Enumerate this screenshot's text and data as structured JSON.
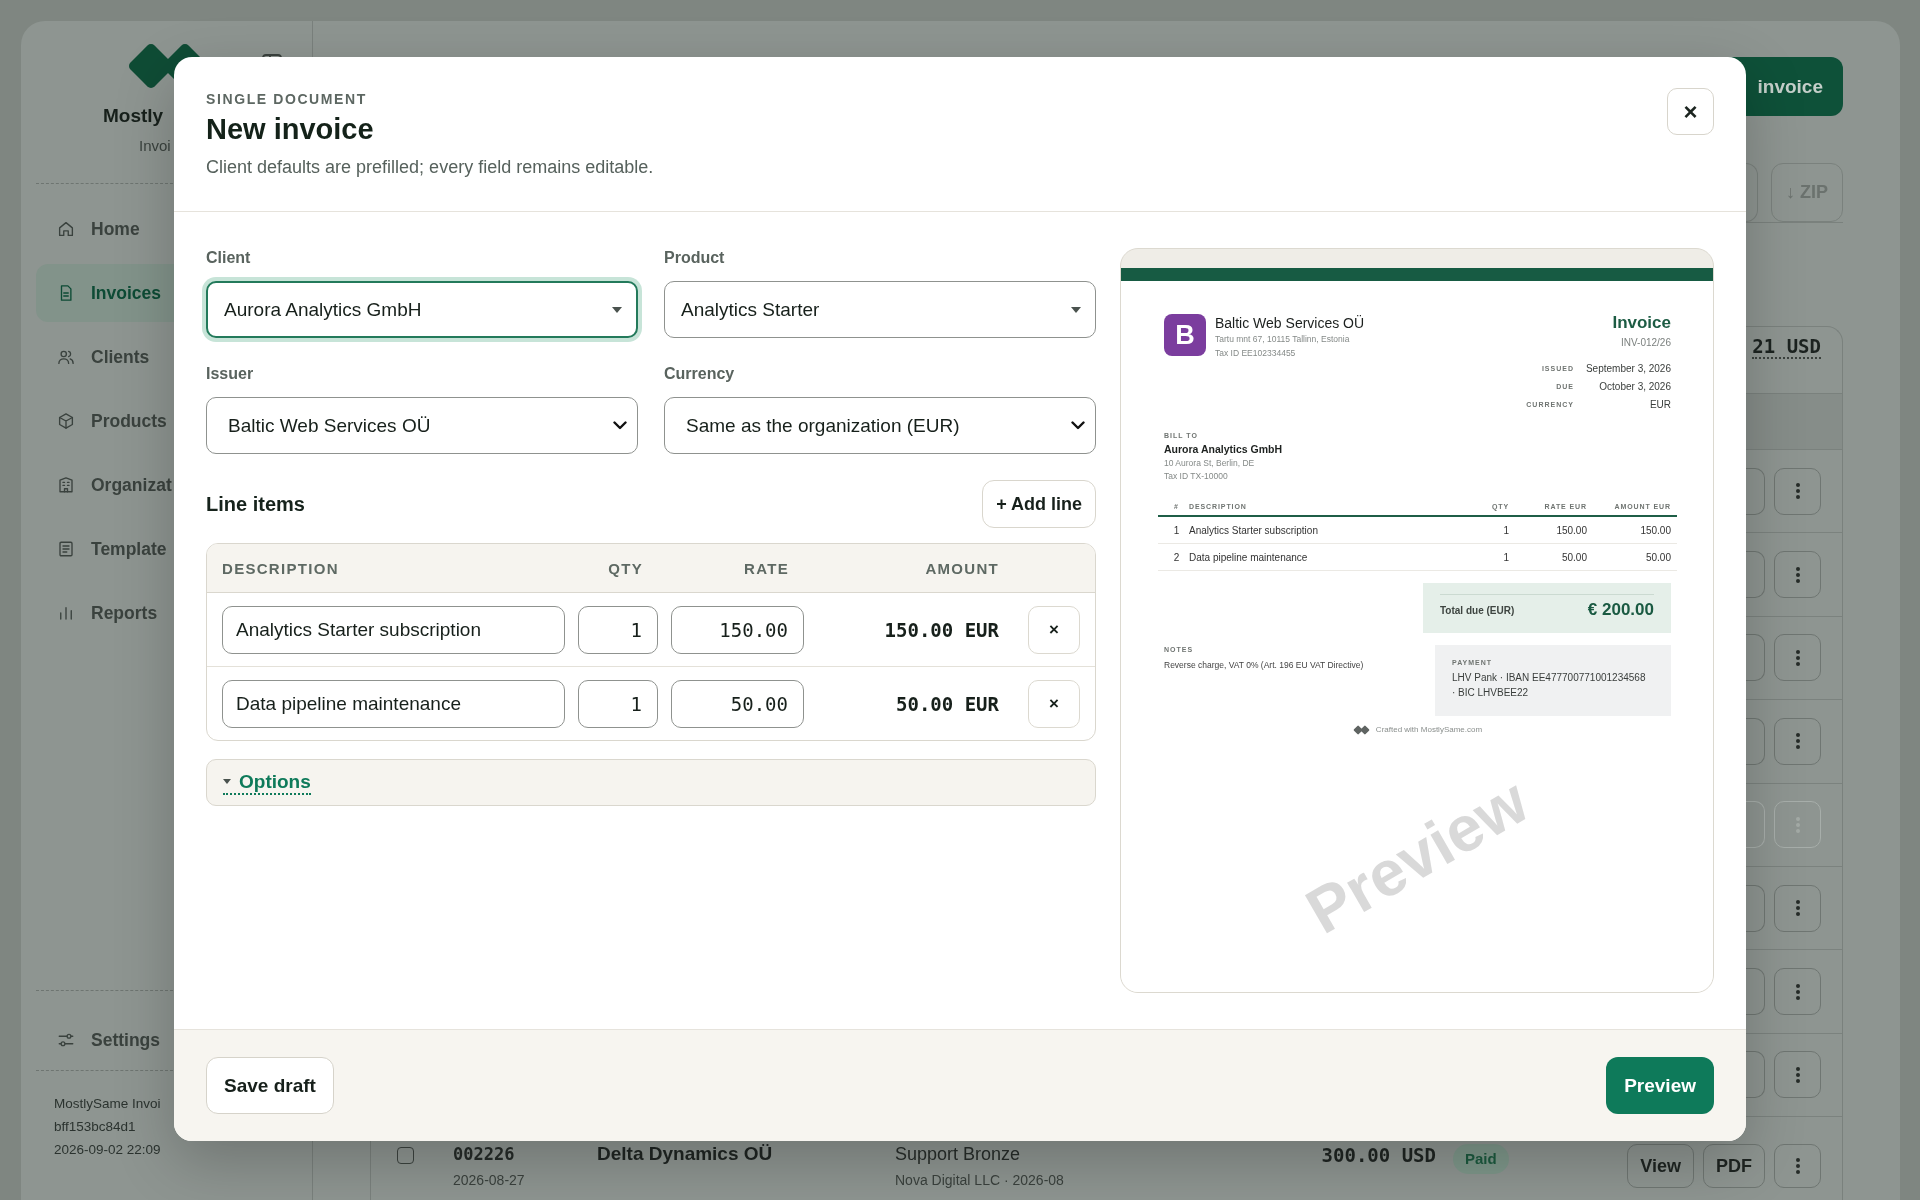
{
  "app": {
    "brand": {
      "name": "Mostly",
      "subtitle": "Invoi"
    },
    "nav": [
      {
        "label": "Home",
        "selected": false
      },
      {
        "label": "Invoices",
        "selected": true
      },
      {
        "label": "Clients",
        "selected": false
      },
      {
        "label": "Products",
        "selected": false
      },
      {
        "label": "Organizat",
        "selected": false
      },
      {
        "label": "Template",
        "selected": false
      },
      {
        "label": "Reports",
        "selected": false
      }
    ],
    "settings": "Settings",
    "build_info": [
      "MostlySame Invoi",
      "bff153bc84d1",
      "2026-09-02 22:09"
    ]
  },
  "main": {
    "new_invoice_button": "invoice",
    "zip_button": {
      "label": "↓ ZIP",
      "disabled": true
    },
    "total": "21 USD",
    "rows": [
      {
        "actions_disabled": false
      },
      {
        "actions_disabled": false
      },
      {
        "actions_disabled": false
      },
      {
        "actions_disabled": false
      },
      {
        "actions_disabled": true
      },
      {
        "actions_disabled": false
      },
      {
        "actions_disabled": false
      },
      {
        "actions_disabled": false
      }
    ],
    "last_row": {
      "checked": false,
      "number": "002226",
      "date": "2026-08-27",
      "client": "Delta Dynamics OÜ",
      "product": "Support Bronze",
      "meta": "Nova Digital LLC · 2026-08",
      "amount": "300.00 USD",
      "status": "Paid",
      "actions": [
        "View",
        "PDF"
      ]
    }
  },
  "modal": {
    "eyebrow": "SINGLE DOCUMENT",
    "title": "New invoice",
    "subtitle": "Client defaults are prefilled; every field remains editable.",
    "close": "×",
    "fields": [
      {
        "label": "Client",
        "value": "Aurora Analytics GmbH",
        "kind": "combobox",
        "focused": true
      },
      {
        "label": "Product",
        "value": "Analytics Starter",
        "kind": "combobox",
        "focused": false
      },
      {
        "label": "Issuer",
        "value": "Baltic Web Services OÜ",
        "kind": "select",
        "focused": false
      },
      {
        "label": "Currency",
        "value": "Same as the organization (EUR)",
        "kind": "select",
        "focused": false
      }
    ],
    "line_items": {
      "title": "Line items",
      "add_button": "+ Add line",
      "columns": [
        "DESCRIPTION",
        "QTY",
        "RATE",
        "AMOUNT"
      ],
      "rows": [
        {
          "description": "Analytics Starter subscription",
          "qty": "1",
          "rate": "150.00",
          "amount": "150.00 EUR",
          "remove": "×"
        },
        {
          "description": "Data pipeline maintenance",
          "qty": "1",
          "rate": "50.00",
          "amount": "50.00 EUR",
          "remove": "×"
        }
      ]
    },
    "options": {
      "label": "Options"
    },
    "footer": {
      "save_draft": "Save draft",
      "preview": "Preview"
    }
  },
  "preview": {
    "logo_letter": "B",
    "issuer": {
      "name": "Baltic Web Services OÜ",
      "address": "Tartu mnt 67, 10115 Tallinn, Estonia",
      "tax_id": "Tax ID EE102334455"
    },
    "doc_title": "Invoice",
    "number": "INV-012/26",
    "meta": [
      {
        "label": "ISSUED",
        "value": "September 3, 2026"
      },
      {
        "label": "DUE",
        "value": "October 3, 2026"
      },
      {
        "label": "CURRENCY",
        "value": "EUR"
      }
    ],
    "bill_to": {
      "label": "BILL TO",
      "name": "Aurora Analytics GmbH",
      "address": "10 Aurora St, Berlin, DE",
      "tax_id": "Tax ID TX-10000"
    },
    "columns": [
      "#",
      "DESCRIPTION",
      "QTY",
      "RATE EUR",
      "AMOUNT EUR"
    ],
    "rows": [
      {
        "number": "1",
        "description": "Analytics Starter subscription",
        "qty": "1",
        "rate": "150.00",
        "amount": "150.00"
      },
      {
        "number": "2",
        "description": "Data pipeline maintenance",
        "qty": "1",
        "rate": "50.00",
        "amount": "50.00"
      }
    ],
    "total": {
      "label": "Total due (EUR)",
      "value": "€ 200.00"
    },
    "notes": {
      "label": "NOTES",
      "text": "Reverse charge, VAT 0% (Art. 196 EU VAT Directive)"
    },
    "payment": {
      "label": "PAYMENT",
      "text": "LHV Pank · IBAN EE477700771001234568 · BIC LHVBEE22"
    },
    "footer": "Crafted with MostlySame.com",
    "watermark": "Preview"
  }
}
